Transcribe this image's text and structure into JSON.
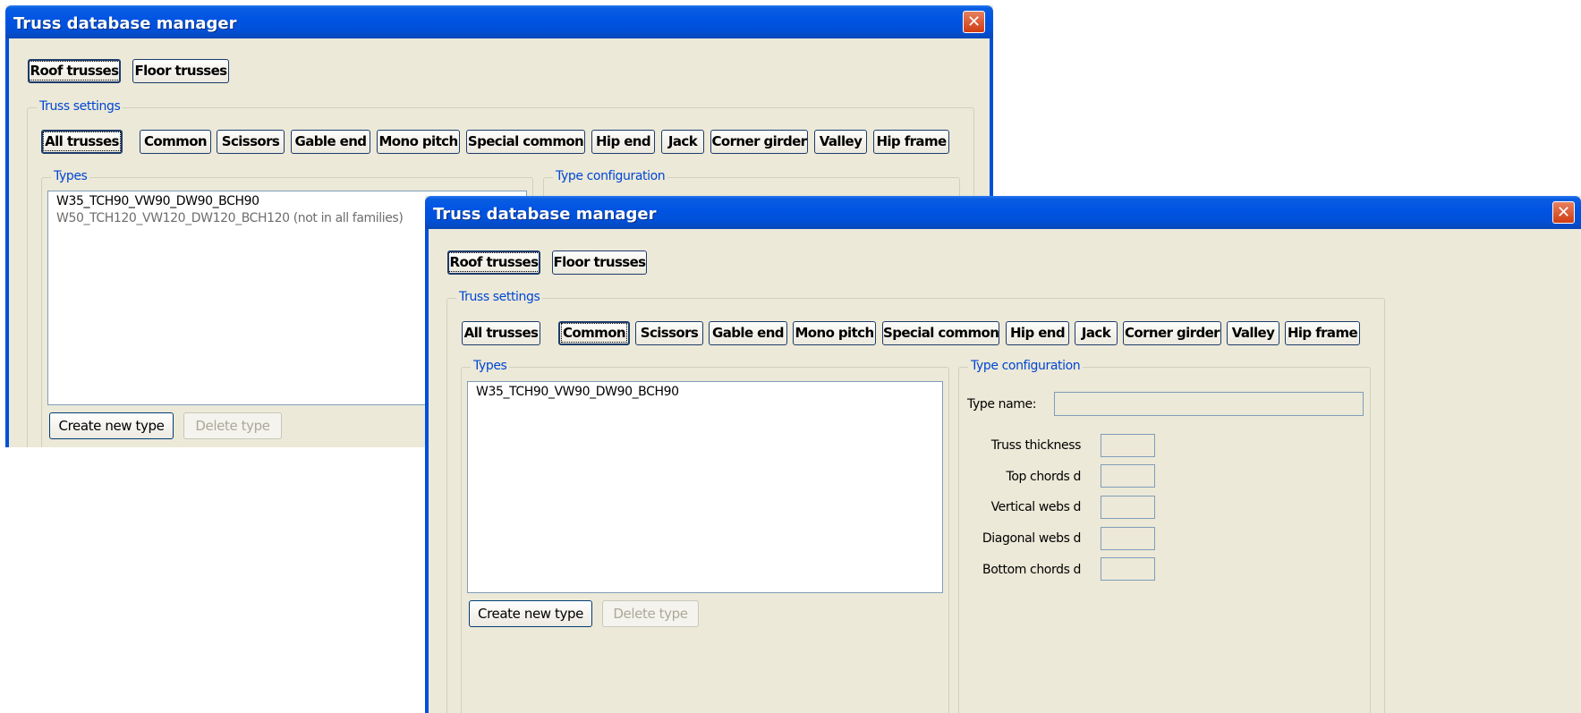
{
  "app": {
    "title": "Truss database manager",
    "close_glyph": "✕",
    "tabs": [
      "Roof trusses",
      "Floor trusses"
    ],
    "truss_settings_legend": "Truss settings",
    "truss_types": [
      "All trusses",
      "Common",
      "Scissors",
      "Gable end",
      "Mono pitch",
      "Special common",
      "Hip end",
      "Jack",
      "Corner girder",
      "Valley",
      "Hip frame"
    ],
    "types_legend": "Types",
    "type_config_legend": "Type configuration",
    "create_new_type": "Create new type",
    "delete_type": "Delete type"
  },
  "back_window": {
    "selected_tab": "Roof trusses",
    "selected_truss_type": "All trusses",
    "types_list": [
      {
        "label": "W35_TCH90_VW90_DW90_BCH90",
        "dimmed": false
      },
      {
        "label": "W50_TCH120_VW120_DW120_BCH120 (not in all families)",
        "dimmed": true
      }
    ]
  },
  "front_window": {
    "selected_tab": "Roof trusses",
    "selected_truss_type": "Common",
    "types_list": [
      {
        "label": "W35_TCH90_VW90_DW90_BCH90",
        "dimmed": false
      }
    ],
    "type_config": {
      "type_name_label": "Type name:",
      "type_name_value": "",
      "fields": [
        {
          "label": "Truss thickness",
          "value": ""
        },
        {
          "label": "Top chords d",
          "value": ""
        },
        {
          "label": "Vertical webs d",
          "value": ""
        },
        {
          "label": "Diagonal webs d",
          "value": ""
        },
        {
          "label": "Bottom chords d",
          "value": ""
        }
      ]
    }
  },
  "colors": {
    "titlebar": "#0054e3",
    "window_bg": "#ece9d8",
    "legend_text": "#0046d5",
    "close_button": "#cf3b12"
  }
}
